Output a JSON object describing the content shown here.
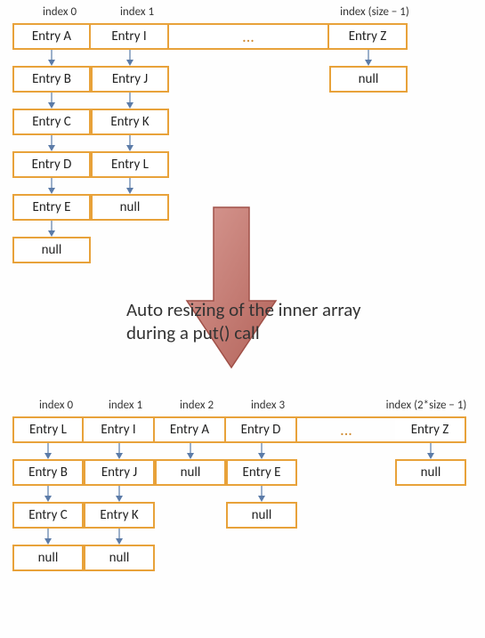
{
  "top": {
    "indexLabels": [
      "index 0",
      "index 1",
      "index (size − 1)"
    ],
    "headRow": [
      "Entry A",
      "Entry I",
      "Entry Z"
    ],
    "ellipsis": "...",
    "chains": {
      "col0": [
        "Entry B",
        "Entry C",
        "Entry D",
        "Entry E",
        "null"
      ],
      "col1": [
        "Entry J",
        "Entry K",
        "Entry L",
        "null"
      ],
      "colLast": [
        "null"
      ]
    }
  },
  "caption": {
    "line1": "Auto resizing of the inner array",
    "line2": "during a put() call"
  },
  "bottom": {
    "indexLabels": [
      "index 0",
      "index 1",
      "index 2",
      "index 3",
      "index (2*size − 1)"
    ],
    "headRow": [
      "Entry L",
      "Entry I",
      "Entry A",
      "Entry D",
      "Entry Z"
    ],
    "ellipsis": "...",
    "chains": {
      "col0": [
        "Entry B",
        "Entry C",
        "null"
      ],
      "col1": [
        "Entry J",
        "Entry K",
        "null"
      ],
      "col2": [
        "null"
      ],
      "col3": [
        "Entry E",
        "null"
      ],
      "colLast": [
        "null"
      ]
    }
  },
  "chart_data": {
    "type": "diagram",
    "title": "HashMap auto-resizing on put()",
    "before": {
      "array_size_label": "size",
      "buckets": [
        {
          "index": 0,
          "chain": [
            "Entry A",
            "Entry B",
            "Entry C",
            "Entry D",
            "Entry E"
          ]
        },
        {
          "index": 1,
          "chain": [
            "Entry I",
            "Entry J",
            "Entry K",
            "Entry L"
          ]
        },
        {
          "index": "size-1",
          "chain": [
            "Entry Z"
          ]
        }
      ]
    },
    "after": {
      "array_size_label": "2*size",
      "buckets": [
        {
          "index": 0,
          "chain": [
            "Entry L",
            "Entry B",
            "Entry C"
          ]
        },
        {
          "index": 1,
          "chain": [
            "Entry I",
            "Entry J",
            "Entry K"
          ]
        },
        {
          "index": 2,
          "chain": [
            "Entry A"
          ]
        },
        {
          "index": 3,
          "chain": [
            "Entry D",
            "Entry E"
          ]
        },
        {
          "index": "2*size-1",
          "chain": [
            "Entry Z"
          ]
        }
      ]
    }
  }
}
